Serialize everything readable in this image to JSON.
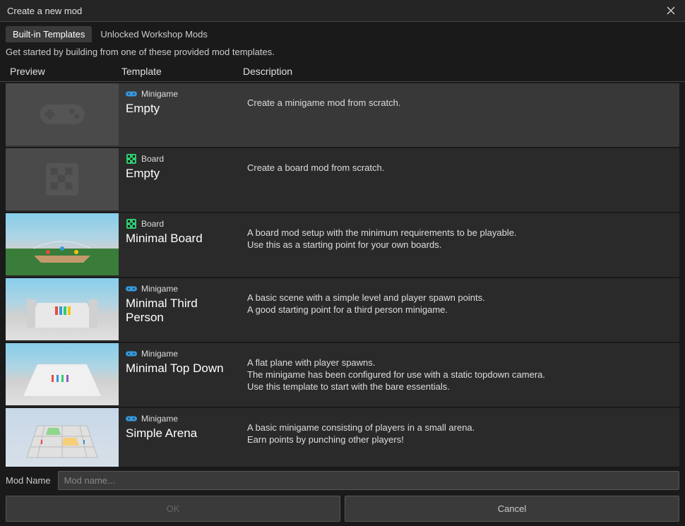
{
  "header": {
    "title": "Create a new mod"
  },
  "tabs": [
    {
      "label": "Built-in Templates",
      "active": true
    },
    {
      "label": "Unlocked Workshop Mods",
      "active": false
    }
  ],
  "subtitle": "Get started by building from one of these provided mod templates.",
  "columns": {
    "preview": "Preview",
    "template": "Template",
    "description": "Description"
  },
  "templates": [
    {
      "category": "Minigame",
      "categoryIcon": "gamepad",
      "name": "Empty",
      "description": "Create a minigame mod from scratch.",
      "preview": "gamepad-placeholder",
      "selected": true
    },
    {
      "category": "Board",
      "categoryIcon": "board",
      "name": "Empty",
      "description": "Create a board mod from scratch.",
      "preview": "board-placeholder",
      "selected": false
    },
    {
      "category": "Board",
      "categoryIcon": "board",
      "name": "Minimal Board",
      "description": "A board mod setup with the minimum requirements to be playable.\nUse this as a starting point for your own boards.",
      "preview": "3d-board",
      "selected": false
    },
    {
      "category": "Minigame",
      "categoryIcon": "gamepad",
      "name": "Minimal Third Person",
      "description": "A basic scene with a simple level and player spawn points.\nA good starting point for a third person minigame.",
      "preview": "3d-thirdperson",
      "selected": false
    },
    {
      "category": "Minigame",
      "categoryIcon": "gamepad",
      "name": "Minimal Top Down",
      "description": "A flat plane with player spawns.\nThe minigame has been configured for use with a static topdown camera.\nUse this template to start with the bare essentials.",
      "preview": "3d-topdown",
      "selected": false
    },
    {
      "category": "Minigame",
      "categoryIcon": "gamepad",
      "name": "Simple Arena",
      "description": "A basic minigame consisting of players in a small arena.\nEarn points by punching other players!",
      "preview": "3d-arena",
      "selected": false
    }
  ],
  "footer": {
    "modNameLabel": "Mod Name",
    "modNamePlaceholder": "Mod name...",
    "okLabel": "OK",
    "cancelLabel": "Cancel"
  },
  "colors": {
    "gamepadIcon": "#3498db",
    "boardIcon": "#2ecc71"
  }
}
